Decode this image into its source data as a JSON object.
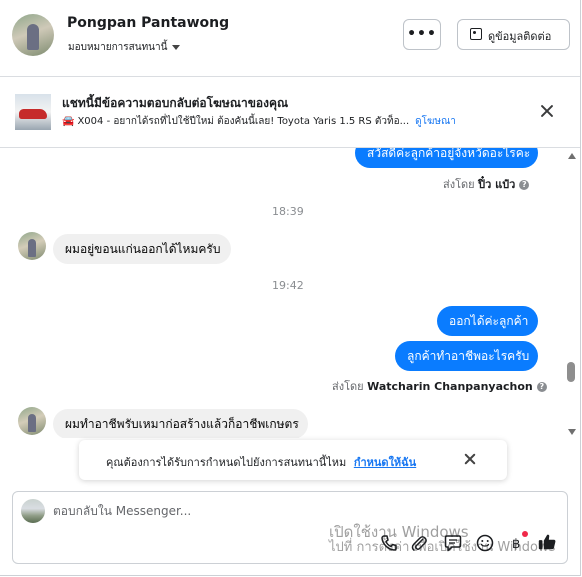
{
  "header": {
    "contact_name": "Pongpan Pantawong",
    "assign_label": "มอบหมายการสนทนานี้",
    "more_label": "•••",
    "view_contact_label": "ดูข้อมูลติดต่อ"
  },
  "ad_banner": {
    "title": "แชทนี้มีข้อความตอบกลับต่อโฆษณาของคุณ",
    "subtitle": "X004 - อยากได้รถที่ไปใช้ปีใหม่ ต้องคันนี้เลย! Toyota Yaris 1.5 RS ตัวท็อ...",
    "link_label": "ดูโฆษณา"
  },
  "messages": {
    "m1_out": "สวัสดีค่ะลูกค้าอยู่จังหวัดอะไรคะ",
    "m1_sentby_prefix": "ส่งโดย",
    "m1_sentby_name": "ปิ๋ว แป๋ว",
    "time1": "18:39",
    "m2_in": "ผมอยู่ขอนแก่นออกได้ไหมครับ",
    "time2": "19:42",
    "m3_out": "ออกได้ค่ะลูกค้า",
    "m4_out": "ลูกค้าทำอาชีพอะไรครับ",
    "m4_sentby_prefix": "ส่งโดย",
    "m4_sentby_name": "Watcharin Chanpanyachon",
    "m5_in": "ผมทำอาชีพรับเหมาก่อสร้างแล้วก็อาชีพเกษตร"
  },
  "toast": {
    "text": "คุณต้องการได้รับการกำหนดไปยังการสนทนานี้ไหม",
    "link": "กำหนดให้ฉัน"
  },
  "composer": {
    "placeholder": "ตอบกลับใน Messenger...",
    "watermark_line1": "เปิดใช้งาน Windows",
    "watermark_line2": "ไปที่ การตั้งค่า เพื่อเปิดใช้งาน Windows"
  },
  "icons": {
    "more": "more-dots-icon",
    "contact": "contact-card-icon",
    "close": "close-icon",
    "car": "car-icon",
    "phone": "phone-icon",
    "attach": "paperclip-icon",
    "saved_replies": "saved-replies-icon",
    "emoji": "emoji-icon",
    "currency": "baht-icon",
    "like": "thumbs-up-icon"
  },
  "colors": {
    "outgoing_bubble": "#0a7cff",
    "incoming_bubble": "#f0f0f0",
    "link": "#1877f2",
    "notification_dot": "#f02849"
  }
}
